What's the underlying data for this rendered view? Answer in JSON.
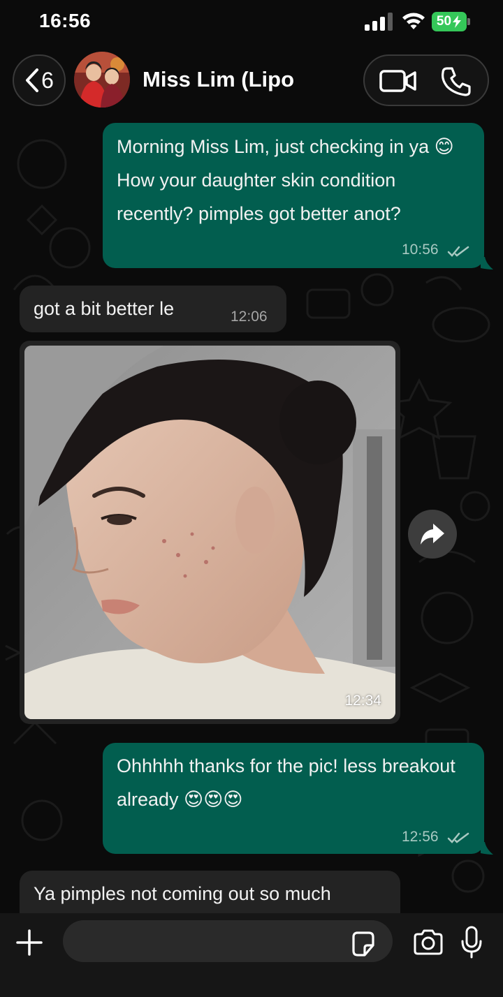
{
  "status_bar": {
    "time": "16:56",
    "battery_level": "50",
    "battery_charging": true,
    "battery_color": "#35c759"
  },
  "header": {
    "unread_count": "6",
    "contact_name": "Miss Lim (Lipo",
    "icons": [
      "chevron-left-icon",
      "video-camera-icon",
      "phone-icon"
    ]
  },
  "messages": [
    {
      "direction": "outgoing",
      "text": "Morning Miss Lim, just checking in ya 😊 How your daughter skin condition recently? pimples got better anot?",
      "time": "10:56",
      "status": "read"
    },
    {
      "direction": "incoming",
      "text": "got a bit better le",
      "time": "12:06"
    },
    {
      "direction": "incoming",
      "type": "photo",
      "time": "12:34"
    },
    {
      "direction": "outgoing",
      "text": "Ohhhhh thanks for the pic! less breakout already 😍😍😍",
      "time": "12:56",
      "status": "read"
    },
    {
      "direction": "incoming",
      "text": "Ya pimples not coming out so much"
    }
  ],
  "composer": {
    "placeholder": "",
    "icons": [
      "plus-icon",
      "sticker-icon",
      "camera-icon",
      "microphone-icon"
    ]
  },
  "colors": {
    "outgoing_bubble": "#025e4f",
    "incoming_bubble": "#232323",
    "background": "#0b0b0b"
  }
}
